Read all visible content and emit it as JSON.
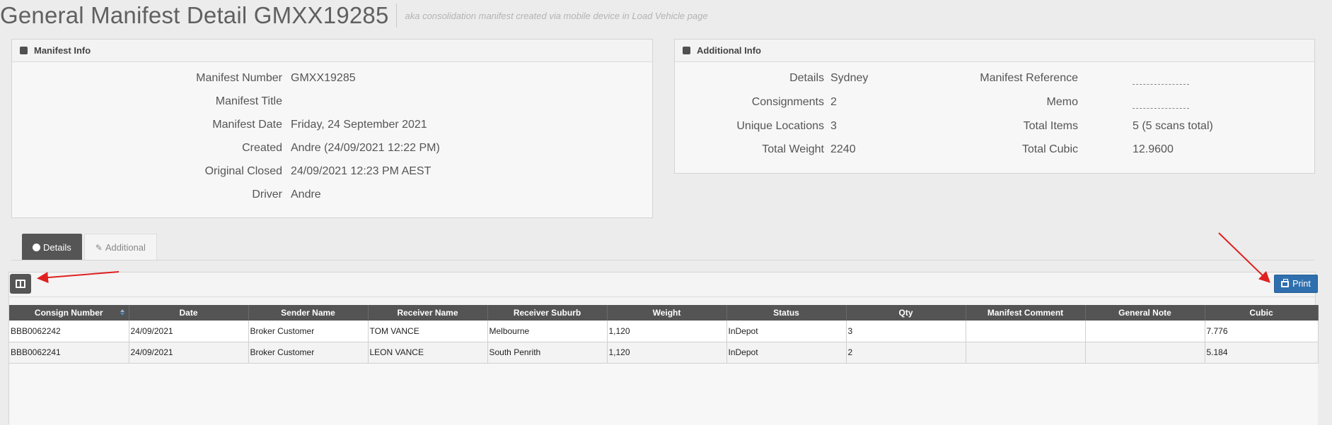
{
  "header": {
    "title": "General Manifest Detail GMXX19285",
    "subtitle": "aka consolidation manifest created via mobile device in Load Vehicle page"
  },
  "manifest_info": {
    "title": "Manifest Info",
    "rows": [
      {
        "label": "Manifest Number",
        "value": "GMXX19285"
      },
      {
        "label": "Manifest Title",
        "value": ""
      },
      {
        "label": "Manifest Date",
        "value": "Friday, 24 September 2021"
      },
      {
        "label": "Created",
        "value": "Andre (24/09/2021 12:22 PM)"
      },
      {
        "label": "Original Closed",
        "value": "24/09/2021 12:23 PM AEST"
      },
      {
        "label": "Driver",
        "value": "Andre"
      }
    ]
  },
  "additional_info": {
    "title": "Additional Info",
    "left_rows": [
      {
        "label": "Details",
        "value": "Sydney"
      },
      {
        "label": "Consignments",
        "value": "2"
      },
      {
        "label": "Unique Locations",
        "value": "3"
      },
      {
        "label": "Total Weight",
        "value": "2240"
      }
    ],
    "right_rows": [
      {
        "label": "Manifest Reference",
        "value": ""
      },
      {
        "label": "Memo",
        "value": ""
      },
      {
        "label": "Total Items",
        "value": "5 (5 scans total)"
      },
      {
        "label": "Total Cubic",
        "value": "12.9600"
      }
    ]
  },
  "tabs": [
    {
      "label": "Details",
      "active": true,
      "icon": "circle-icon"
    },
    {
      "label": "Additional",
      "active": false,
      "icon": "pencil-icon"
    }
  ],
  "toolbar": {
    "columns_icon": "columns-icon",
    "print_label": "Print"
  },
  "grid": {
    "columns": [
      "Consign Number",
      "Date",
      "Sender Name",
      "Receiver Name",
      "Receiver Suburb",
      "Weight",
      "Status",
      "Qty",
      "Manifest Comment",
      "General Note",
      "Cubic"
    ],
    "rows": [
      [
        "BBB0062242",
        "24/09/2021",
        "Broker Customer",
        "TOM VANCE",
        "Melbourne",
        "1,120",
        "InDepot",
        "3",
        "",
        "",
        "7.776"
      ],
      [
        "BBB0062241",
        "24/09/2021",
        "Broker Customer",
        "LEON VANCE",
        "South Penrith",
        "1,120",
        "InDepot",
        "2",
        "",
        "",
        "5.184"
      ]
    ]
  },
  "colors": {
    "header_bg": "#545454",
    "print_button": "#2f6fae",
    "annotation_arrow": "#e02020"
  }
}
